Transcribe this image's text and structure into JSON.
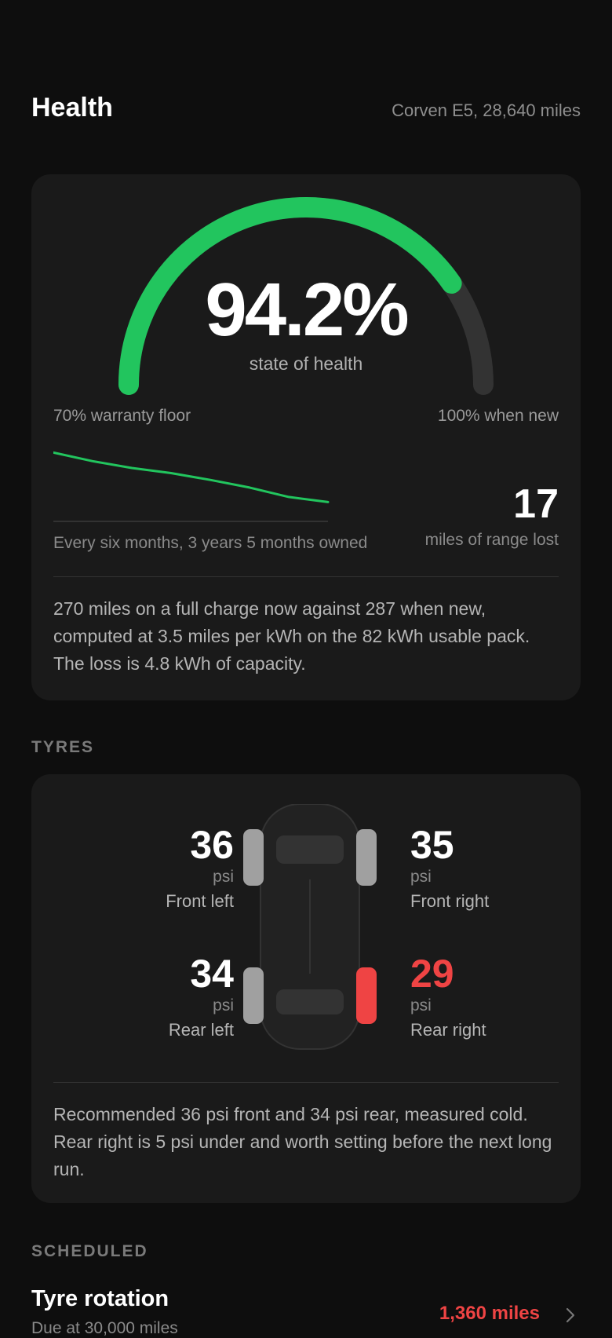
{
  "header": {
    "title": "Health",
    "vehicle": "Corven E5, 28,640 miles"
  },
  "health": {
    "soh_value": "94.2%",
    "soh_label": "state of health",
    "soh_percent": 94.2,
    "gauge_min_value": 70,
    "gauge_max_value": 100,
    "gauge_min_label": "70% warranty floor",
    "gauge_max_label": "100% when new",
    "trend_caption": "Every six months, 3 years 5 months owned",
    "range_lost_value": "17",
    "range_lost_label": "miles of range lost",
    "description": "270 miles on a full charge now against 287 when new, computed at 3.5 miles per kWh on the 82 kWh usable pack. The loss is 4.8 kWh of capacity.",
    "colors": {
      "good": "#22c55e",
      "track": "#333333"
    }
  },
  "chart_data": {
    "type": "line",
    "x": [
      0,
      1,
      2,
      3,
      4,
      5,
      6,
      7
    ],
    "series": [
      {
        "values": [
          100,
          99.0,
          98.2,
          97.6,
          96.8,
          95.9,
          94.8,
          94.2
        ]
      }
    ],
    "ylim": [
      93.5,
      100.5
    ],
    "grid": false
  },
  "tyres": {
    "section_label": "TYRES",
    "unit": "psi",
    "front_left": {
      "value": "36",
      "label": "Front left",
      "status": "ok"
    },
    "front_right": {
      "value": "35",
      "label": "Front right",
      "status": "ok"
    },
    "rear_left": {
      "value": "34",
      "label": "Rear left",
      "status": "ok"
    },
    "rear_right": {
      "value": "29",
      "label": "Rear right",
      "status": "low"
    },
    "note": "Recommended 36 psi front and 34 psi rear, measured cold. Rear right is 5 psi under and worth setting before the next long run.",
    "colors": {
      "ok": "#a0a0a0",
      "low": "#ef4444"
    }
  },
  "scheduled": {
    "section_label": "SCHEDULED",
    "items": [
      {
        "title": "Tyre rotation",
        "detail": "Due at 30,000 miles",
        "value": "1,360 miles",
        "icon": "chevron-right-icon"
      }
    ]
  }
}
